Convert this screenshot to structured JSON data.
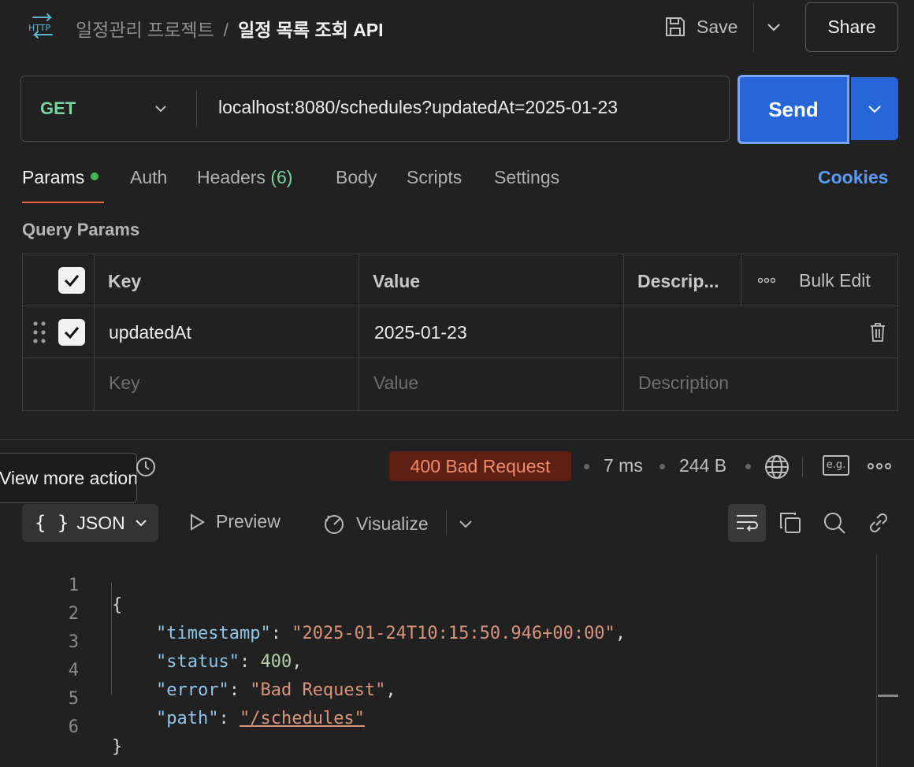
{
  "header": {
    "icon": "http-icon",
    "breadcrumb_parent": "일정관리 프로젝트",
    "breadcrumb_sep": "/",
    "breadcrumb_current": "일정 목록 조회 API",
    "save_label": "Save",
    "share_label": "Share"
  },
  "request": {
    "method": "GET",
    "url": "localhost:8080/schedules?updatedAt=2025-01-23",
    "send_label": "Send"
  },
  "tabs": {
    "params": "Params",
    "auth": "Auth",
    "headers": "Headers",
    "headers_count": "(6)",
    "body": "Body",
    "scripts": "Scripts",
    "settings": "Settings",
    "cookies": "Cookies"
  },
  "params": {
    "title": "Query Params",
    "col_key": "Key",
    "col_value": "Value",
    "col_desc": "Descrip...",
    "bulk_edit": "Bulk Edit",
    "rows": [
      {
        "key": "updatedAt",
        "value": "2025-01-23",
        "checked": true
      }
    ],
    "placeholder_key": "Key",
    "placeholder_value": "Value",
    "placeholder_desc": "Description"
  },
  "response": {
    "tooltip": "View more actions",
    "status": "400 Bad Request",
    "time": "7 ms",
    "size": "244 B",
    "format": "JSON",
    "preview": "Preview",
    "visualize": "Visualize",
    "eg": "e.g."
  },
  "colors": {
    "accent_send": "#2666d9",
    "method_get": "#7bd3a2",
    "status_error_bg": "#5c2114",
    "status_error_text": "#f08a6b",
    "cookies_link": "#5b9bf5",
    "tab_underline": "#e8663f"
  },
  "code": {
    "line_numbers": [
      "1",
      "2",
      "3",
      "4",
      "5",
      "6"
    ],
    "open_brace": "{",
    "close_brace": "}",
    "fields": [
      {
        "key": "\"timestamp\"",
        "value": "\"2025-01-24T10:15:50.946+00:00\"",
        "type": "string",
        "comma": ","
      },
      {
        "key": "\"status\"",
        "value": "400",
        "type": "number",
        "comma": ","
      },
      {
        "key": "\"error\"",
        "value": "\"Bad Request\"",
        "type": "string",
        "comma": ","
      },
      {
        "key": "\"path\"",
        "value": "\"/schedules\"",
        "type": "link",
        "comma": ""
      }
    ]
  }
}
